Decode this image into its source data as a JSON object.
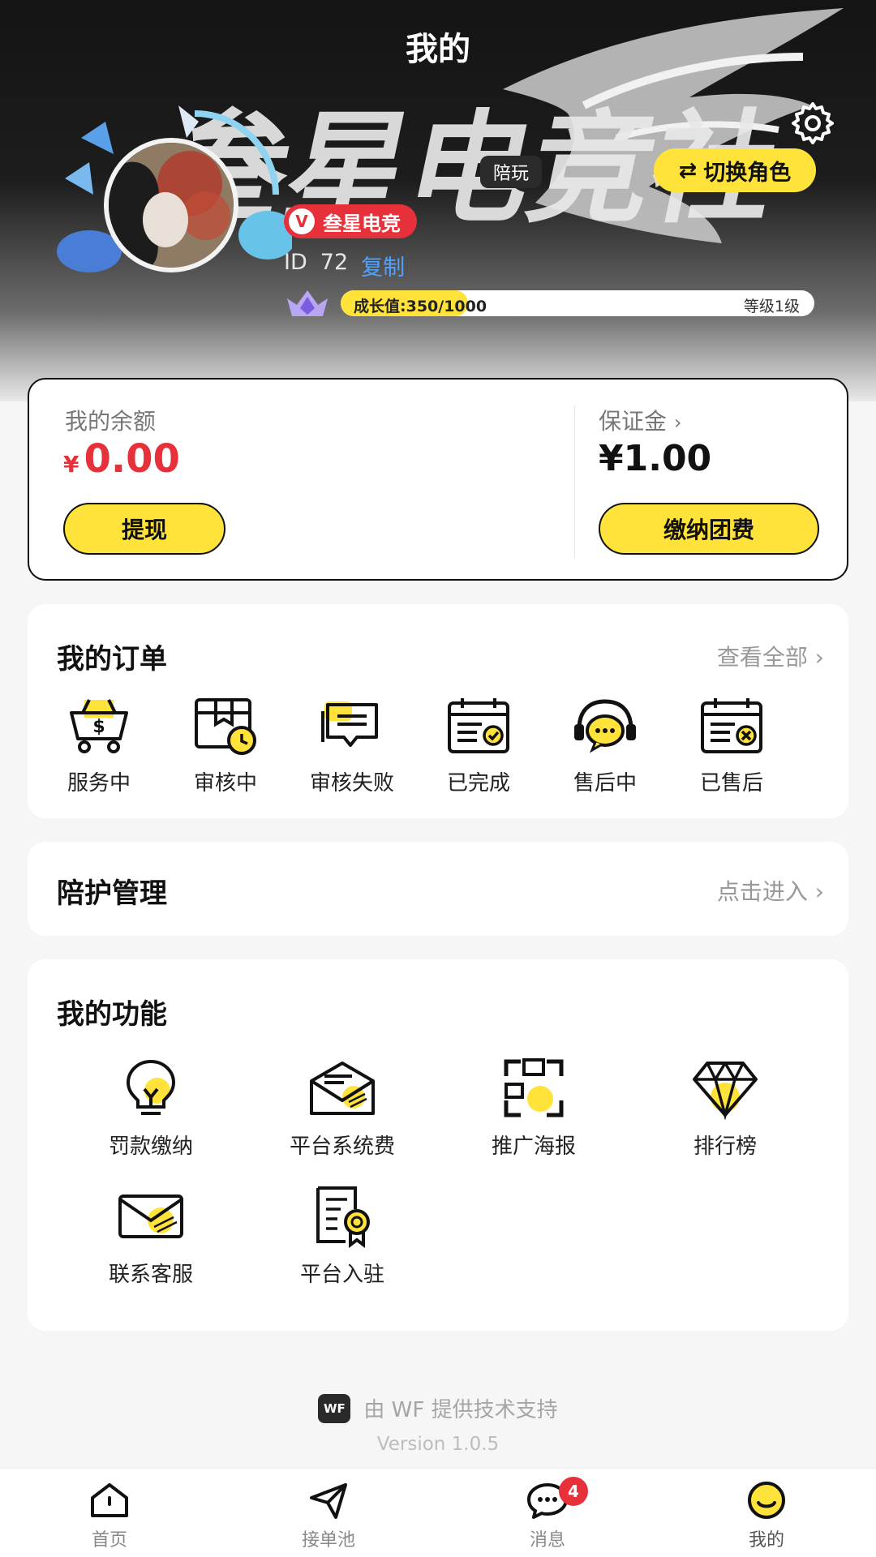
{
  "header": {
    "title": "我的",
    "switch_role_label": "切换角色",
    "role_tag": "陪玩",
    "club_name": "叁星电竞",
    "id_label": "ID",
    "id_value": "72",
    "copy_label": "复制",
    "growth_text": "成长值:350/1000",
    "growth_current": 350,
    "growth_max": 1000,
    "level_text": "等级1级",
    "banner_art_text": "叁星电竞社"
  },
  "balance": {
    "label": "我的余额",
    "currency": "¥",
    "amount": "0.00",
    "withdraw_label": "提现",
    "deposit_label": "保证金",
    "deposit_arrow": "›",
    "deposit_amount": "¥1.00",
    "pay_label": "缴纳团费"
  },
  "orders": {
    "title": "我的订单",
    "view_all": "查看全部 ›",
    "items": [
      {
        "label": "服务中",
        "icon": "basket-dollar-icon"
      },
      {
        "label": "审核中",
        "icon": "box-clock-icon"
      },
      {
        "label": "审核失败",
        "icon": "message-stack-icon"
      },
      {
        "label": "已完成",
        "icon": "calendar-check-icon"
      },
      {
        "label": "售后中",
        "icon": "headset-chat-icon"
      },
      {
        "label": "已售后",
        "icon": "calendar-x-icon"
      }
    ]
  },
  "escort": {
    "title": "陪护管理",
    "link": "点击进入 ›"
  },
  "features": {
    "title": "我的功能",
    "items": [
      {
        "label": "罚款缴纳",
        "icon": "lightbulb-icon"
      },
      {
        "label": "平台系统费",
        "icon": "envelope-open-icon"
      },
      {
        "label": "推广海报",
        "icon": "frame-icon"
      },
      {
        "label": "排行榜",
        "icon": "diamond-icon"
      },
      {
        "label": "联系客服",
        "icon": "envelope-icon"
      },
      {
        "label": "平台入驻",
        "icon": "certificate-icon"
      }
    ]
  },
  "footer": {
    "logo_text": "WF",
    "powered_text": "由 WF 提供技术支持",
    "version": "Version 1.0.5"
  },
  "tabbar": {
    "items": [
      {
        "label": "首页",
        "icon": "home-icon"
      },
      {
        "label": "接单池",
        "icon": "send-icon"
      },
      {
        "label": "消息",
        "icon": "chat-icon",
        "badge": "4"
      },
      {
        "label": "我的",
        "icon": "smile-icon",
        "active": true
      }
    ]
  },
  "colors": {
    "accent": "#ffe33a",
    "danger": "#e6303a",
    "link": "#4fa3ff"
  }
}
